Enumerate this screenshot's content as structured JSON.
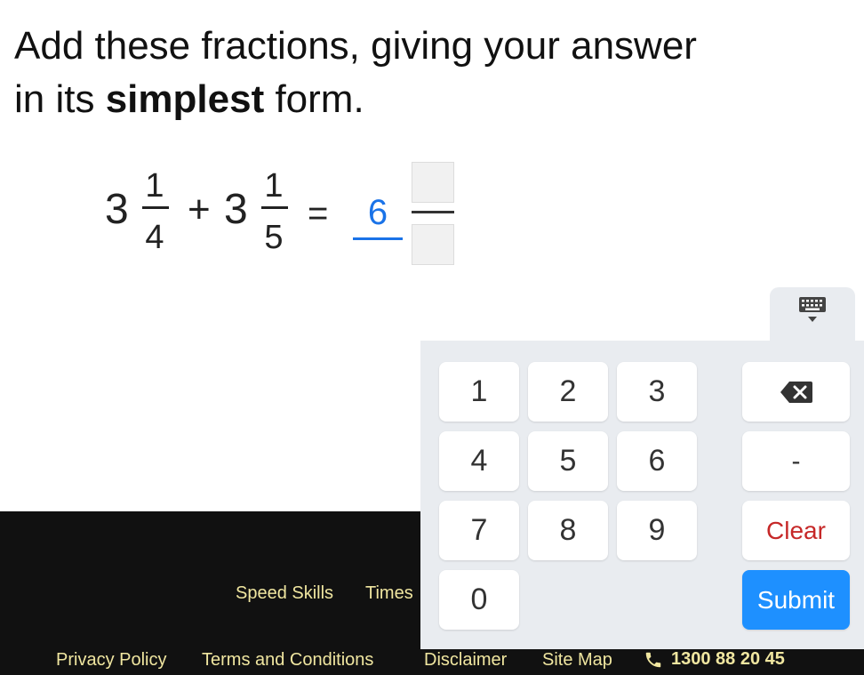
{
  "question": {
    "line1": "Add these fractions, giving your answer",
    "line2_pre": "in its ",
    "line2_bold": "simplest",
    "line2_post": " form."
  },
  "equation": {
    "term1": {
      "whole": "3",
      "numerator": "1",
      "denominator": "4"
    },
    "plus": "+",
    "term2": {
      "whole": "3",
      "numerator": "1",
      "denominator": "5"
    },
    "equals": "=",
    "answer": {
      "whole_value": "6",
      "numerator_value": "",
      "denominator_value": ""
    }
  },
  "keypad": {
    "keys": [
      "1",
      "2",
      "3",
      "4",
      "5",
      "6",
      "7",
      "8",
      "9",
      "0"
    ],
    "minus": "-",
    "clear": "Clear",
    "submit": "Submit",
    "backspace_icon": "backspace-icon",
    "toggle_icon": "keyboard-icon"
  },
  "footer": {
    "row1": [
      "Speed Skills",
      "Times"
    ],
    "row2": [
      "Privacy Policy",
      "Terms and Conditions",
      "Disclaimer",
      "Site Map"
    ],
    "phone": "1300 88 20 45",
    "phone_icon": "phone-icon"
  },
  "colors": {
    "accent": "#1a73e8",
    "submit": "#1e90ff",
    "clear": "#c62828",
    "footer_bg": "#111111",
    "footer_text": "#f0e6a0",
    "keypad_bg": "#e9ecf0"
  }
}
